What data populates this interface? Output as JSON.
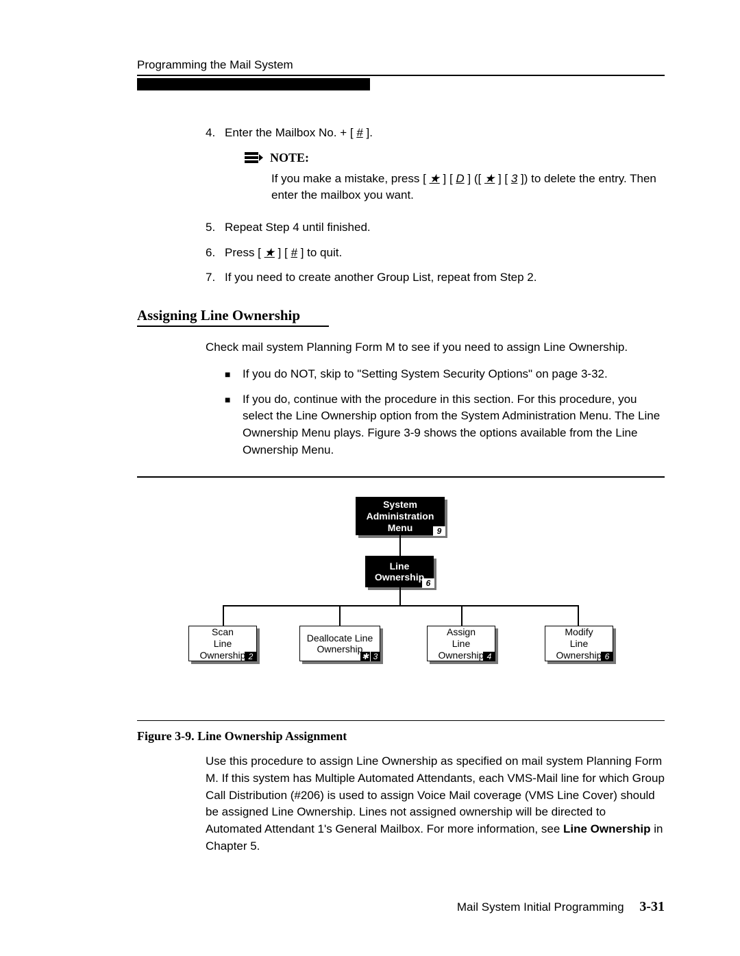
{
  "running_head": "Programming the Mail System",
  "steps": {
    "s4": {
      "num": "4.",
      "text_a": "Enter the Mailbox No. + [ ",
      "key": "#",
      "text_b": " ]."
    },
    "note": {
      "label": "NOTE:",
      "pre": "If you make a mistake, press [ ",
      "k1": "★",
      "mid1": " ] [ ",
      "k2": "D",
      "mid2": " ] ([ ",
      "k3": "★",
      "mid3": " ] [ ",
      "k4": "3",
      "post": " ]) to delete the entry. Then enter the mailbox you want."
    },
    "s5": {
      "num": "5.",
      "text": "Repeat Step 4 until finished."
    },
    "s6": {
      "num": "6.",
      "pre": "Press [ ",
      "k1": "★",
      "mid": " ] [ ",
      "k2": "#",
      "post": " ] to quit."
    },
    "s7": {
      "num": "7.",
      "text": "If you need to create another Group List, repeat from Step 2."
    }
  },
  "section_title": "Assigning Line Ownership",
  "para1": "Check mail system Planning Form M to see if you need to assign Line Ownership.",
  "bullets": {
    "b1": "If you do NOT, skip to \"Setting System Security Options\" on page 3-32.",
    "b2": "If you do, continue with the procedure in this section. For this procedure, you select the Line Ownership option from the System Administration Menu. The Line Ownership Menu plays. Figure 3-9 shows the options available from the Line Ownership Menu."
  },
  "diagram": {
    "top": {
      "l1": "System",
      "l2": "Administration",
      "l3": "Menu",
      "badge": "9"
    },
    "mid": {
      "l1": "Line",
      "l2": "Ownership",
      "badge": "6"
    },
    "leaf1": {
      "l1": "Scan",
      "l2": "Line",
      "l3": "Ownership",
      "badge": "2"
    },
    "leaf2": {
      "l1": "Deallocate Line",
      "l2": "Ownership",
      "badge_a": "✱",
      "badge_b": "3"
    },
    "leaf3": {
      "l1": "Assign",
      "l2": "Line",
      "l3": "Ownership",
      "badge": "4"
    },
    "leaf4": {
      "l1": "Modify",
      "l2": "Line",
      "l3": "Ownership",
      "badge": "6"
    }
  },
  "fig_caption": "Figure 3-9. Line Ownership Assignment",
  "para2_a": "Use this procedure to assign Line Ownership as specified on mail system Planning Form M. If this system has Multiple Automated Attendants, each VMS-Mail line for which Group Call Distribution (#206) is used to assign Voice Mail coverage (VMS Line Cover) should be assigned Line Ownership. Lines not assigned ownership will be directed to Automated Attendant 1's General Mailbox. For more information, see ",
  "para2_bold": "Line Ownership",
  "para2_b": " in Chapter 5.",
  "footer_text": "Mail System Initial Programming",
  "footer_page": "3-31"
}
